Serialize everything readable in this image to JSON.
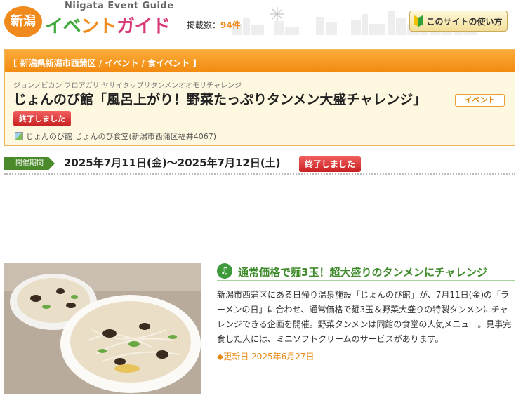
{
  "header": {
    "logo_circle": "新潟",
    "logo_en": "Niigata Event Guide",
    "logo_ja_1": "イベ",
    "logo_ja_2": "ント",
    "logo_ja_3": "ガイド",
    "count_label": "掲載数：",
    "count_value": "94件",
    "howto_button": "このサイトの使い方"
  },
  "panel": {
    "breadcrumb": "[ 新潟県新潟市西蒲区 / イベント / 食イベント ]",
    "kana": "ジョンノビカン フロアガリ ヤサイタップリタンメンオオモリチャレンジ",
    "title": "じょんのび館「風呂上がり！野菜たっぷりタンメン大盛チャレンジ」",
    "category_badge": "イベント",
    "status": "終了しました",
    "venue": "じょんのび館 じょんのび食堂(新潟市西蒲区福井4067)"
  },
  "period": {
    "label": "開催期間",
    "dates": "2025年7月11日(金)〜2025年7月12日(土)",
    "status": "終了しました"
  },
  "article": {
    "title": "通常価格で麺3玉！超大盛りのタンメンにチャレンジ",
    "body": "新潟市西蒲区にある日帰り温泉施設「じょんのび館」が、7月11日(金)の「ラーメンの日」に合わせ、通常価格で麺3玉＆野菜大盛りの特製タンメンにチャレンジできる企画を開催。野菜タンメンは同館の食堂の人気メニュー。見事完食した人には、ミニソフトクリームのサービスがあります。",
    "updated": "◆更新日 2025年6月27日"
  },
  "colors": {
    "orange": "#f08a1c",
    "green": "#3d8a2a",
    "red": "#c81f1f"
  }
}
